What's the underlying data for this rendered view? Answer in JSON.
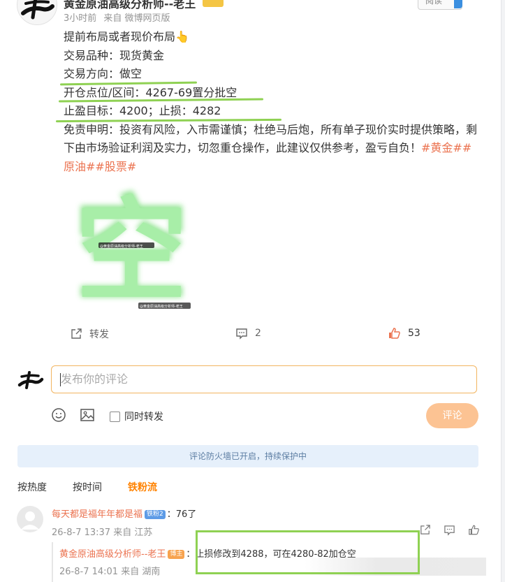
{
  "post": {
    "author_name": "黄金原油高级分析师--老王",
    "time": "3小时前",
    "source": "来自 微博网页版",
    "read_button": "阅读",
    "lines": [
      "提前布局或者现价布局👆",
      "交易品种：现货黄金",
      "交易方向：做空",
      "开仓点位/区间：4267-69置分批空",
      "止盈目标：4200；止损：4282"
    ],
    "disclaimer": "免责申明：投资有风险，入市需谨慎；杜绝马后炮，所有单子现价实时提供策略，剩下由市场验证利润及实力，切忽重仓操作，此建议仅供参考，盈亏自负！",
    "tags": [
      "#黄金#",
      "#原油#",
      "#股票#"
    ],
    "image_char": "空",
    "image_watermark_1": "@黄金原油高级分析师-老王",
    "image_watermark_2": "@黄金原油高级分析师-老王",
    "annotation_color": "#8fd153"
  },
  "actions": {
    "repost_label": "转发",
    "comment_count": "2",
    "like_count": "53",
    "like_color": "#eb7350"
  },
  "composer": {
    "placeholder": "发布你的评论",
    "repost_checkbox_label": "同时转发",
    "submit_label": "评论"
  },
  "firewall_notice": "评论防火墙已开启，持续保护中",
  "sort_tabs": [
    {
      "label": "按热度"
    },
    {
      "label": "按时间"
    },
    {
      "label": "铁粉流"
    }
  ],
  "comments": [
    {
      "user": "每天都是福年年都是福",
      "badge": "铁粉2",
      "text": "：76了",
      "date": "26-8-7 13:37",
      "location": "来自 江苏",
      "reply": {
        "user": "黄金原油高级分析师--老王",
        "badge": "博主",
        "text": "：止损修改到4288，可在4280-82加仓空",
        "date": "26-8-7 14:01",
        "location": "来自 湖南"
      }
    }
  ]
}
